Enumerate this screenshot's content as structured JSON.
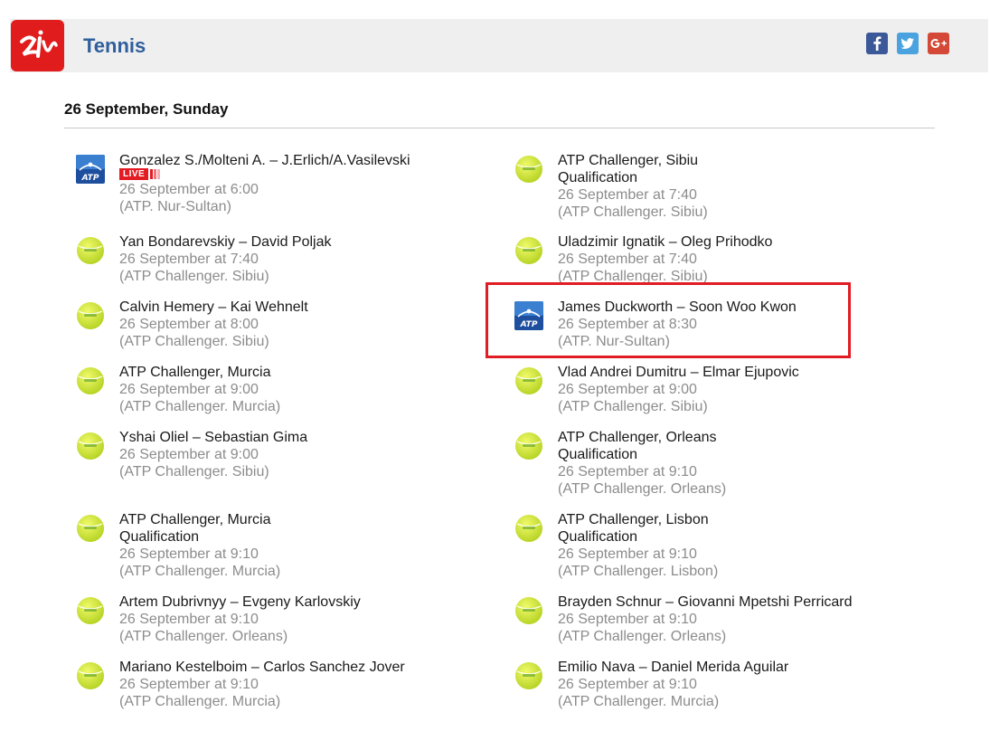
{
  "header": {
    "title": "Tennis",
    "logo": "sport-logo",
    "social": [
      "facebook-icon",
      "twitter-icon",
      "google-plus-icon"
    ]
  },
  "date_heading": "26 September, Sunday",
  "live_label": "LIVE",
  "colors": {
    "accent": "#2f5f9c",
    "header_bg": "#efefef",
    "logo_red": "#e01c1c",
    "live_red": "#e31b23",
    "highlight_red": "#e01c24"
  },
  "events": {
    "left": [
      {
        "icon": "atp-icon",
        "lines": [
          "Gonzalez S./Molteni A. – J.Erlich/A.Vasilevski"
        ],
        "live": true,
        "time": "26 September at 6:00",
        "tournament": "(ATP. Nur-Sultan)"
      },
      {
        "icon": "tennis-ball-icon",
        "lines": [
          "Yan Bondarevskiy – David Poljak"
        ],
        "time": "26 September at 7:40",
        "tournament": "(ATP Challenger. Sibiu)"
      },
      {
        "icon": "tennis-ball-icon",
        "lines": [
          "Calvin Hemery – Kai Wehnelt"
        ],
        "time": "26 September at 8:00",
        "tournament": "(ATP Challenger. Sibiu)"
      },
      {
        "icon": "tennis-ball-icon",
        "lines": [
          "ATP Challenger, Murcia"
        ],
        "time": "26 September at 9:00",
        "tournament": "(ATP Challenger. Murcia)"
      },
      {
        "icon": "tennis-ball-icon",
        "lines": [
          "Yshai Oliel – Sebastian Gima"
        ],
        "time": "26 September at 9:00",
        "tournament": "(ATP Challenger. Sibiu)"
      },
      {
        "icon": "tennis-ball-icon",
        "lines": [
          "ATP Challenger, Murcia",
          "Qualification"
        ],
        "time": "26 September at 9:10",
        "tournament": "(ATP Challenger. Murcia)"
      },
      {
        "icon": "tennis-ball-icon",
        "lines": [
          "Artem Dubrivnyy – Evgeny Karlovskiy"
        ],
        "time": "26 September at 9:10",
        "tournament": "(ATP Challenger. Orleans)"
      },
      {
        "icon": "tennis-ball-icon",
        "lines": [
          "Mariano Kestelboim – Carlos Sanchez Jover"
        ],
        "time": "26 September at 9:10",
        "tournament": "(ATP Challenger. Murcia)"
      }
    ],
    "right": [
      {
        "icon": "tennis-ball-icon",
        "lines": [
          "ATP Challenger, Sibiu",
          "Qualification"
        ],
        "time": "26 September at 7:40",
        "tournament": "(ATP Challenger. Sibiu)"
      },
      {
        "icon": "tennis-ball-icon",
        "lines": [
          "Uladzimir Ignatik – Oleg Prihodko"
        ],
        "time": "26 September at 7:40",
        "tournament": "(ATP Challenger. Sibiu)"
      },
      {
        "icon": "atp-icon",
        "lines": [
          "James Duckworth – Soon Woo Kwon"
        ],
        "time": "26 September at 8:30",
        "tournament": "(ATP. Nur-Sultan)",
        "highlighted": true
      },
      {
        "icon": "tennis-ball-icon",
        "lines": [
          "Vlad Andrei Dumitru – Elmar Ejupovic"
        ],
        "time": "26 September at 9:00",
        "tournament": "(ATP Challenger. Sibiu)"
      },
      {
        "icon": "tennis-ball-icon",
        "lines": [
          "ATP Challenger, Orleans",
          "Qualification"
        ],
        "time": "26 September at 9:10",
        "tournament": "(ATP Challenger. Orleans)"
      },
      {
        "icon": "tennis-ball-icon",
        "lines": [
          "ATP Challenger, Lisbon",
          "Qualification"
        ],
        "time": "26 September at 9:10",
        "tournament": "(ATP Challenger. Lisbon)"
      },
      {
        "icon": "tennis-ball-icon",
        "lines": [
          "Brayden Schnur – Giovanni Mpetshi Perricard"
        ],
        "time": "26 September at 9:10",
        "tournament": "(ATP Challenger. Orleans)"
      },
      {
        "icon": "tennis-ball-icon",
        "lines": [
          "Emilio Nava – Daniel Merida Aguilar"
        ],
        "time": "26 September at 9:10",
        "tournament": "(ATP Challenger. Murcia)"
      }
    ]
  }
}
